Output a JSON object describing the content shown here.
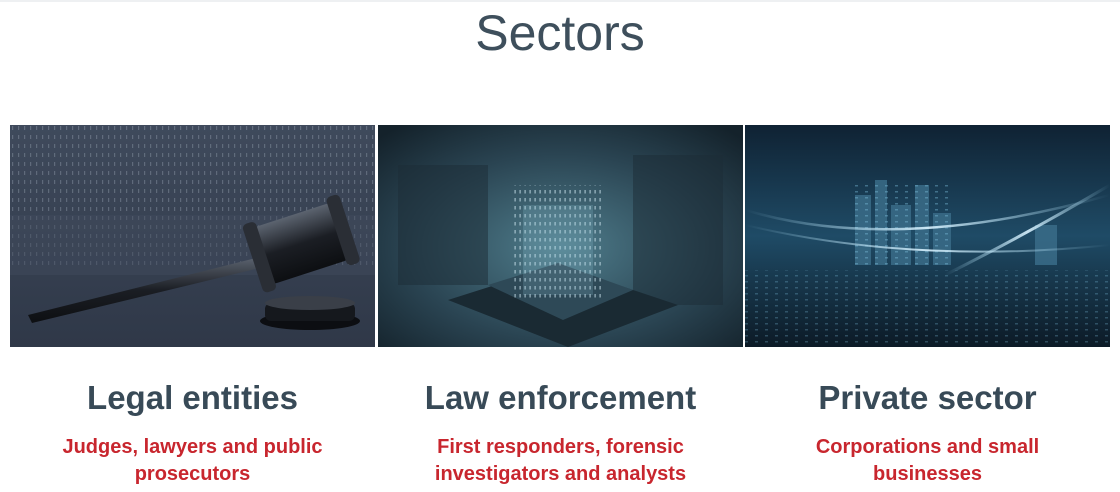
{
  "heading": "Sectors",
  "sectors": [
    {
      "title": "Legal entities",
      "subtitle": "Judges, lawyers and public prosecutors",
      "image_icon": "gavel-image"
    },
    {
      "title": "Law enforcement",
      "subtitle": "First responders, forensic investigators and analysts",
      "image_icon": "circuit-chip-image"
    },
    {
      "title": "Private sector",
      "subtitle": "Corporations and small businesses",
      "image_icon": "city-lights-image"
    }
  ],
  "colors": {
    "heading": "#3e4f5c",
    "card_title": "#384a57",
    "subtitle": "#c8262e"
  }
}
